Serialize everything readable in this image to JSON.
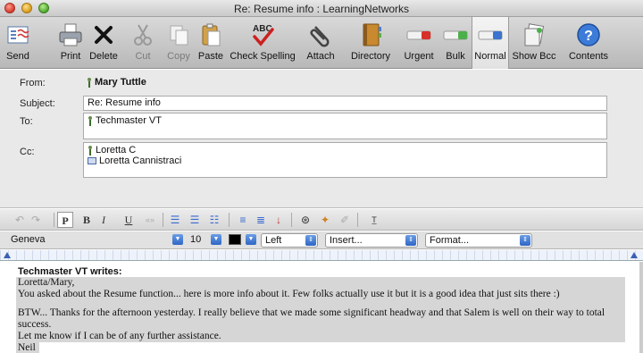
{
  "window": {
    "title": "Re: Resume info : LearningNetworks"
  },
  "toolbar": {
    "send": "Send",
    "print": "Print",
    "delete": "Delete",
    "cut": "Cut",
    "copy": "Copy",
    "paste": "Paste",
    "check_spelling": "Check Spelling",
    "attach": "Attach",
    "directory": "Directory",
    "urgent": "Urgent",
    "bulk": "Bulk",
    "normal": "Normal",
    "show_bcc": "Show Bcc",
    "contents": "Contents",
    "spelling_icon_text": "ABC"
  },
  "headers": {
    "from_label": "From:",
    "from_value": "Mary Tuttle",
    "subject_label": "Subject:",
    "subject_value": "Re: Resume info",
    "to_label": "To:",
    "to_value": "Techmaster VT",
    "cc_label": "Cc:",
    "cc_values": [
      "Loretta C",
      "Loretta Cannistraci"
    ]
  },
  "format": {
    "font": "Geneva",
    "size": "10",
    "align": "Left",
    "insert": "Insert...",
    "format": "Format...",
    "bold": "B",
    "italic": "I",
    "underline": "U",
    "plain": "P"
  },
  "message": {
    "writes": "Techmaster VT writes:",
    "lines": [
      "Loretta/Mary,",
      " You asked about the Resume function... here is more info about it. Few folks actually use it but it is a good idea that just sits there :)",
      "",
      "BTW... Thanks for the afternoon yesterday. I really believe that we made some significant headway and that Salem is well on their way to total success.",
      "Let me know if I can be of any further assistance.",
      "Neil"
    ]
  }
}
